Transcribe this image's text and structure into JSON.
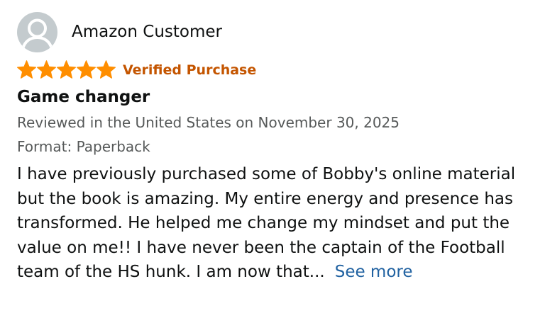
{
  "review": {
    "reviewer_name": "Amazon Customer",
    "rating": 5,
    "rating_max": 5,
    "star_color": "#ff8e00",
    "verified_label": "Verified Purchase",
    "title": "Game changer",
    "date_text": "Reviewed in the United States on November 30, 2025",
    "format_text": "Format: Paperback",
    "body_text": "I have previously purchased some of Bobby's online material but the book is amazing. My entire energy and presence has transformed. He helped me change my mindset and put the value on me!! I have never been the captain of the Football team of the HS hunk. I am now that...",
    "see_more_label": "See more",
    "colors": {
      "verified": "#c45500",
      "link": "#2162a1",
      "muted": "#565959"
    },
    "icons": {
      "avatar": "user-silhouette-icon",
      "star": "star-icon"
    }
  }
}
